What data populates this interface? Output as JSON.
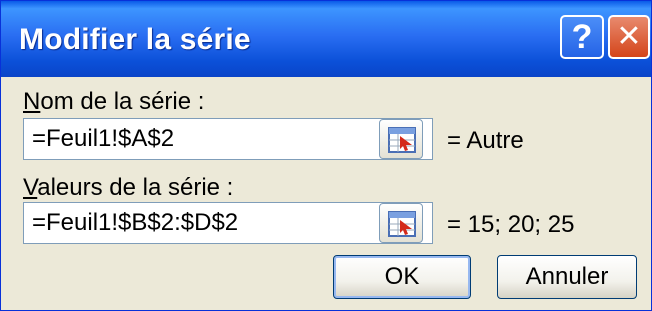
{
  "dialog": {
    "title": "Modifier la série",
    "help_glyph": "?",
    "close_glyph": "✕"
  },
  "series_name": {
    "label_mnemonic": "N",
    "label_rest": "om de la série :",
    "value": "=Feuil1!$A$2",
    "result": "= Autre"
  },
  "series_values": {
    "label_mnemonic": "V",
    "label_rest": "aleurs de la série :",
    "value": "=Feuil1!$B$2:$D$2",
    "result": "= 15; 20; 25"
  },
  "buttons": {
    "ok": "OK",
    "cancel": "Annuler"
  },
  "icons": {
    "title_help": "help-icon",
    "title_close": "close-icon",
    "range_picker": "collapse-dialog-icon"
  }
}
